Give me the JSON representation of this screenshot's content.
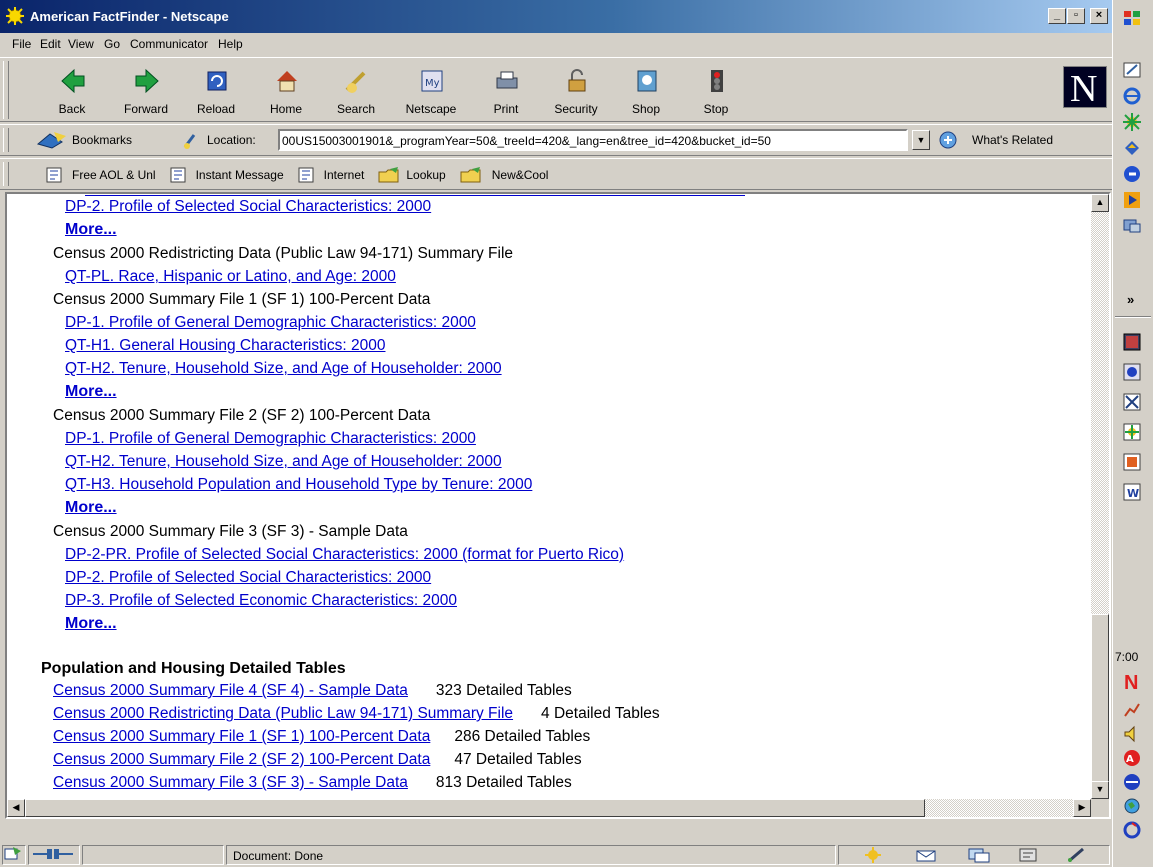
{
  "window": {
    "title": "American FactFinder - Netscape",
    "minimize": "_",
    "maximize": "▫",
    "close": "×"
  },
  "menu": [
    "File",
    "Edit",
    "View",
    "Go",
    "Communicator",
    "Help"
  ],
  "nav_buttons": [
    "Back",
    "Forward",
    "Reload",
    "Home",
    "Search",
    "Netscape",
    "Print",
    "Security",
    "Shop",
    "Stop"
  ],
  "netscape_logo": "N",
  "location_bar": {
    "bookmarks_label": "Bookmarks",
    "location_label": "Location:",
    "url": "00US15003001901&_programYear=50&_treeId=420&_lang=en&tree_id=420&bucket_id=50",
    "whats_related": "What's Related"
  },
  "personal_bar": [
    "Free AOL & Unl",
    "Instant Message",
    "Internet",
    "Lookup",
    "New&Cool"
  ],
  "content": {
    "lines": [
      {
        "kind": "link",
        "text": "DP-2. Profile of Selected Social Characteristics:  2000"
      },
      {
        "kind": "more",
        "text": "More..."
      },
      {
        "kind": "text",
        "text": "Census 2000 Redistricting Data (Public Law 94-171) Summary File"
      },
      {
        "kind": "link",
        "text": "QT-PL. Race, Hispanic or Latino, and Age:  2000"
      },
      {
        "kind": "text",
        "text": "Census 2000 Summary File 1 (SF 1) 100-Percent Data"
      },
      {
        "kind": "link",
        "text": "DP-1. Profile of General Demographic Characteristics:  2000"
      },
      {
        "kind": "link",
        "text": "QT-H1. General Housing Characteristics:  2000"
      },
      {
        "kind": "link",
        "text": "QT-H2. Tenure, Household Size, and Age of Householder:  2000"
      },
      {
        "kind": "more",
        "text": "More..."
      },
      {
        "kind": "text",
        "text": "Census 2000 Summary File 2 (SF 2) 100-Percent Data"
      },
      {
        "kind": "link",
        "text": "DP-1. Profile of General Demographic Characteristics:  2000"
      },
      {
        "kind": "link",
        "text": "QT-H2. Tenure, Household Size, and Age of Householder:  2000"
      },
      {
        "kind": "link",
        "text": "QT-H3. Household Population and Household Type by Tenure:  2000"
      },
      {
        "kind": "more",
        "text": "More..."
      },
      {
        "kind": "text",
        "text": "Census 2000 Summary File 3 (SF 3) - Sample Data"
      },
      {
        "kind": "link",
        "text": "DP-2-PR. Profile of Selected Social Characteristics:  2000 (format for Puerto Rico)"
      },
      {
        "kind": "link",
        "text": "DP-2. Profile of Selected Social Characteristics:  2000"
      },
      {
        "kind": "link",
        "text": "DP-3. Profile of Selected Economic Characteristics:  2000"
      },
      {
        "kind": "more",
        "text": "More..."
      }
    ],
    "detailed_heading": "Population and Housing Detailed Tables",
    "detailed": [
      {
        "link": "Census 2000 Summary File 4 (SF 4) - Sample Data",
        "count": "323 Detailed Tables"
      },
      {
        "link": "Census 2000 Redistricting Data (Public Law 94-171) Summary File",
        "count": "4 Detailed Tables"
      },
      {
        "link": "Census 2000 Summary File 1 (SF 1) 100-Percent Data",
        "count": "286 Detailed Tables"
      },
      {
        "link": "Census 2000 Summary File 2 (SF 2) 100-Percent Data",
        "count": "47 Detailed Tables"
      },
      {
        "link": "Census 2000 Summary File 3 (SF 3) - Sample Data",
        "count": "813 Detailed Tables"
      }
    ]
  },
  "status": {
    "text": "Document: Done"
  },
  "taskbar": {
    "clock": "7:00",
    "more": "»"
  }
}
